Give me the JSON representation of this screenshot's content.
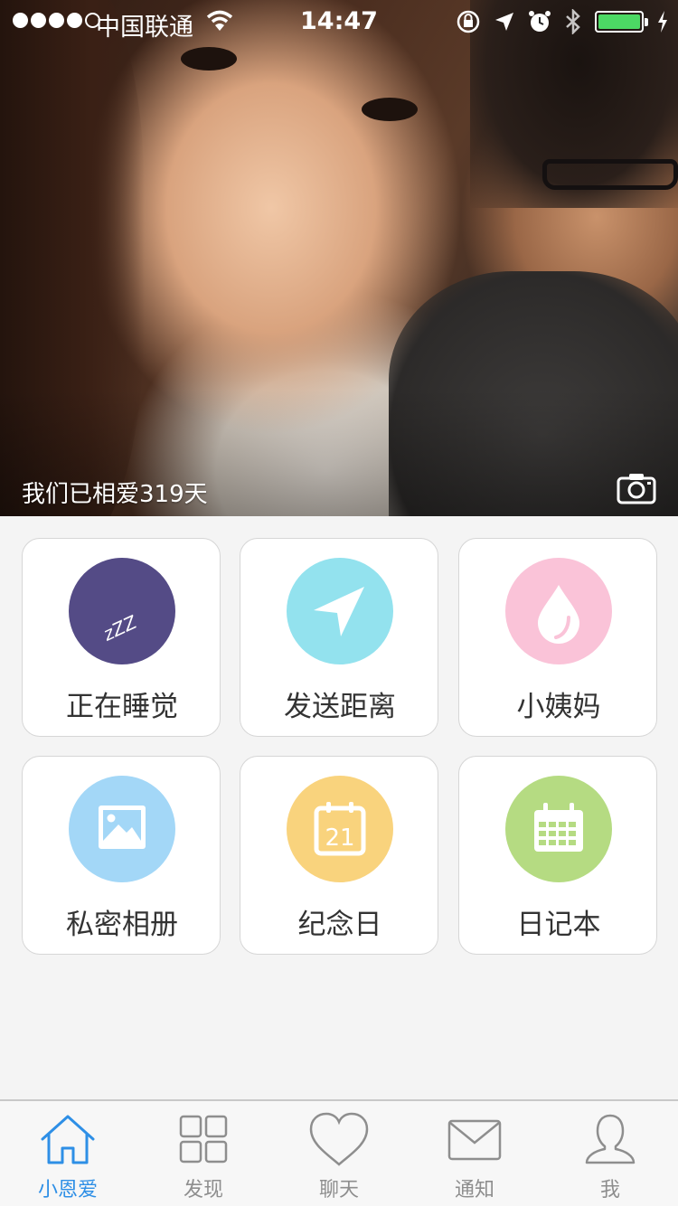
{
  "status_bar": {
    "carrier": "中国联通",
    "time": "14:47",
    "signal_strength": 4,
    "battery_color": "#4cd964"
  },
  "hero": {
    "together_text": "我们已相爱319天",
    "camera_icon": "camera-icon"
  },
  "features": [
    {
      "label": "正在睡觉",
      "icon": "sleep-zzz-icon",
      "color": "#544b86"
    },
    {
      "label": "发送距离",
      "icon": "location-arrow-icon",
      "color": "#93e2ee"
    },
    {
      "label": "小姨妈",
      "icon": "drop-icon",
      "color": "#fac3d8"
    },
    {
      "label": "私密相册",
      "icon": "photo-icon",
      "color": "#a3d7f7"
    },
    {
      "label": "纪念日",
      "icon": "calendar-21-icon",
      "color": "#f9d37d"
    },
    {
      "label": "日记本",
      "icon": "calendar-grid-icon",
      "color": "#b5db82"
    }
  ],
  "calendar_day": "21",
  "sleep_text": "zZZ",
  "tabs": [
    {
      "label": "小恩爱",
      "icon": "home-icon",
      "active": true
    },
    {
      "label": "发现",
      "icon": "grid-icon",
      "active": false
    },
    {
      "label": "聊天",
      "icon": "heart-icon",
      "active": false
    },
    {
      "label": "通知",
      "icon": "envelope-icon",
      "active": false
    },
    {
      "label": "我",
      "icon": "person-icon",
      "active": false
    }
  ],
  "colors": {
    "accent": "#2e8fe6",
    "tab_inactive": "#8e8e8e",
    "background": "#f4f4f4"
  }
}
